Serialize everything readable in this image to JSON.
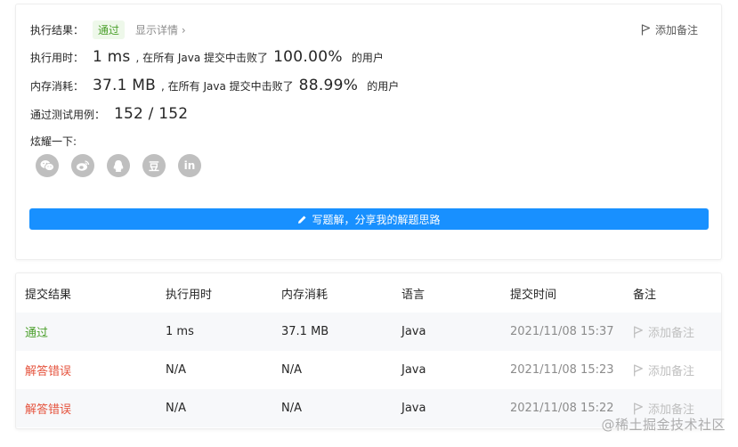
{
  "summary": {
    "result_label": "执行结果：",
    "result_value": "通过",
    "detail_link": "显示详情 ›",
    "add_note": "添加备注",
    "runtime": {
      "label": "执行用时：",
      "value": "1 ms",
      "middle": ", 在所有 Java 提交中击败了",
      "percent": "100.00%",
      "suffix": "的用户"
    },
    "memory": {
      "label": "内存消耗：",
      "value": "37.1 MB",
      "middle": ", 在所有 Java 提交中击败了",
      "percent": "88.99%",
      "suffix": "的用户"
    },
    "tests": {
      "label": "通过测试用例：",
      "value": "152 / 152"
    },
    "share_label": "炫耀一下:",
    "share_icons": [
      "wechat-icon",
      "weibo-icon",
      "qq-icon",
      "douban-icon",
      "linkedin-icon"
    ],
    "douban_glyph": "豆",
    "linkedin_glyph": "in",
    "write_button": "写题解，分享我的解题思路"
  },
  "table": {
    "headers": [
      "提交结果",
      "执行用时",
      "内存消耗",
      "语言",
      "提交时间",
      "备注"
    ],
    "rows": [
      {
        "result": "通过",
        "status": "ok",
        "runtime": "1 ms",
        "memory": "37.1 MB",
        "language": "Java",
        "time": "2021/11/08 15:37",
        "note": "添加备注"
      },
      {
        "result": "解答错误",
        "status": "error",
        "runtime": "N/A",
        "memory": "N/A",
        "language": "Java",
        "time": "2021/11/08 15:23",
        "note": "添加备注"
      },
      {
        "result": "解答错误",
        "status": "error",
        "runtime": "N/A",
        "memory": "N/A",
        "language": "Java",
        "time": "2021/11/08 15:22",
        "note": "添加备注"
      }
    ]
  },
  "colors": {
    "accent": "#1890ff",
    "success": "#4a9f2a",
    "error": "#e5533d",
    "muted": "#8c8c8c"
  },
  "watermark": "@稀土掘金技术社区"
}
